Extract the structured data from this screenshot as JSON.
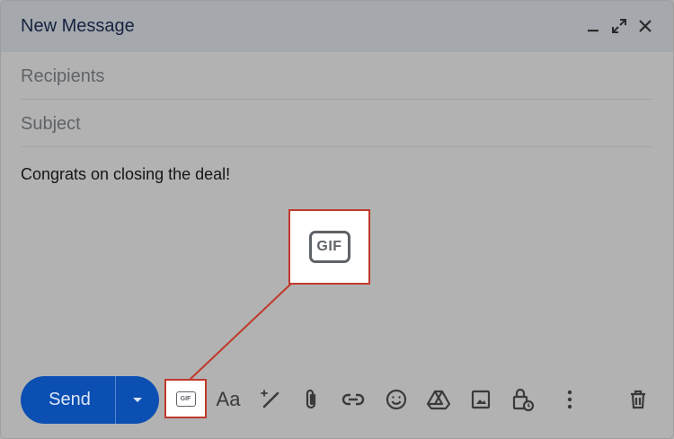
{
  "header": {
    "title": "New Message",
    "controls": [
      "minimize-icon",
      "expand-icon",
      "close-icon"
    ]
  },
  "compose": {
    "recipients_placeholder": "Recipients",
    "subject_placeholder": "Subject",
    "body": "Congrats on closing the deal!"
  },
  "callout": {
    "label": "GIF"
  },
  "toolbar": {
    "send_label": "Send",
    "send_more_icon": "dropdown-arrow-icon",
    "gif_label": "GIF",
    "format_label": "Aa",
    "tools": [
      "gif-icon",
      "formatting-icon",
      "ai-pen-icon",
      "attach-icon",
      "link-icon",
      "emoji-icon",
      "drive-icon",
      "photo-icon",
      "confidential-lock-icon",
      "more-options-icon",
      "trash-icon"
    ]
  },
  "colors": {
    "send": "#0b4fb3",
    "highlight": "#c0392b"
  }
}
